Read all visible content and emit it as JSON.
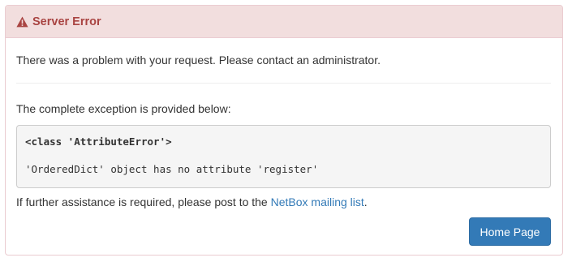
{
  "heading": {
    "icon": "warning-icon",
    "title": "Server Error",
    "color": "#a94442",
    "background": "#f2dede"
  },
  "body": {
    "message": "There was a problem with your request. Please contact an administrator.",
    "exception_label": "The complete exception is provided below:",
    "exception_class": "<class 'AttributeError'>",
    "exception_message": "'OrderedDict' object has no attribute 'register'",
    "help_prefix": "If further assistance is required, please post to the ",
    "help_link": "NetBox mailing list",
    "help_suffix": "."
  },
  "actions": {
    "home_label": "Home Page",
    "home_color": "#337ab7"
  }
}
